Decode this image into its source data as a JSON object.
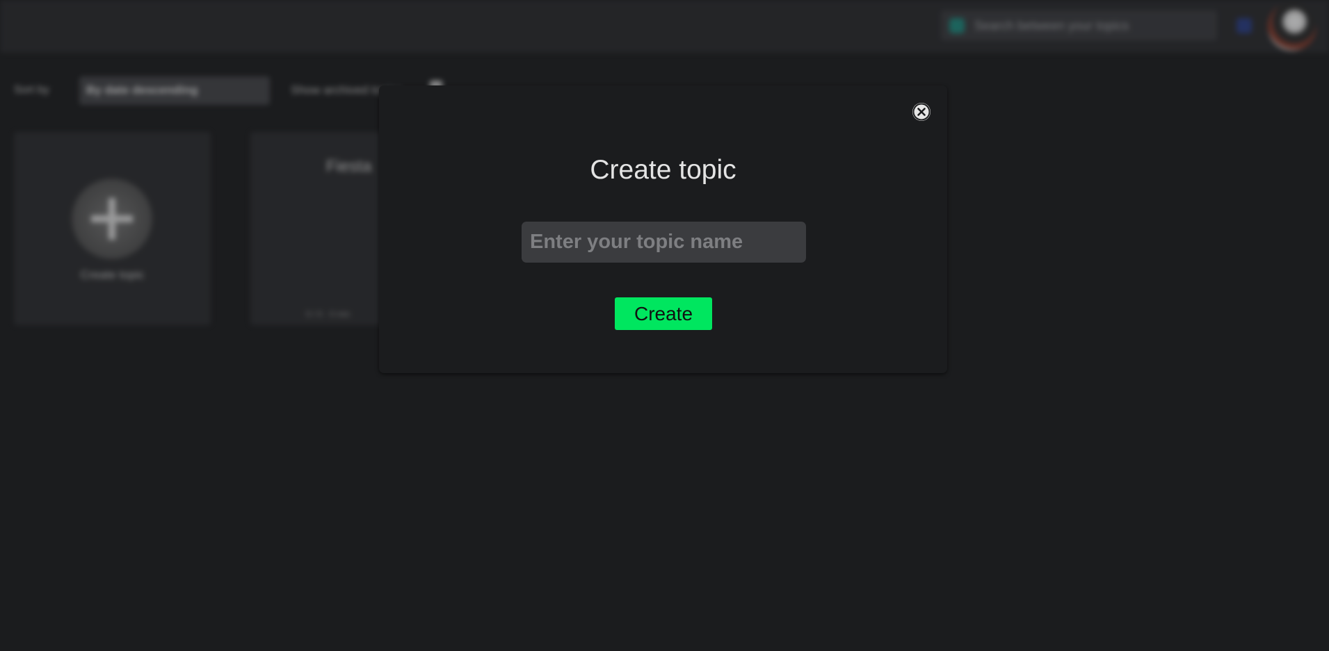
{
  "background": {
    "search": {
      "placeholder": "Search between your topics"
    },
    "sort": {
      "label": "Sort by",
      "value": "By date descending"
    },
    "archived": {
      "label": "Show archived topics"
    },
    "cards": {
      "create_label": "Create topic",
      "topic_title": "Fiesta",
      "topic_footer": "0 / 0 · 0 min"
    }
  },
  "modal": {
    "title": "Create topic",
    "input": {
      "placeholder": "Enter your topic name",
      "value": ""
    },
    "create_label": "Create"
  },
  "colors": {
    "accent": "#00e65f",
    "modal_bg": "#1b1c1e",
    "input_bg": "#3b3c3f"
  },
  "icons": {
    "close": "close-icon",
    "plus": "plus-icon",
    "search": "search-icon",
    "notify": "notification-icon"
  }
}
